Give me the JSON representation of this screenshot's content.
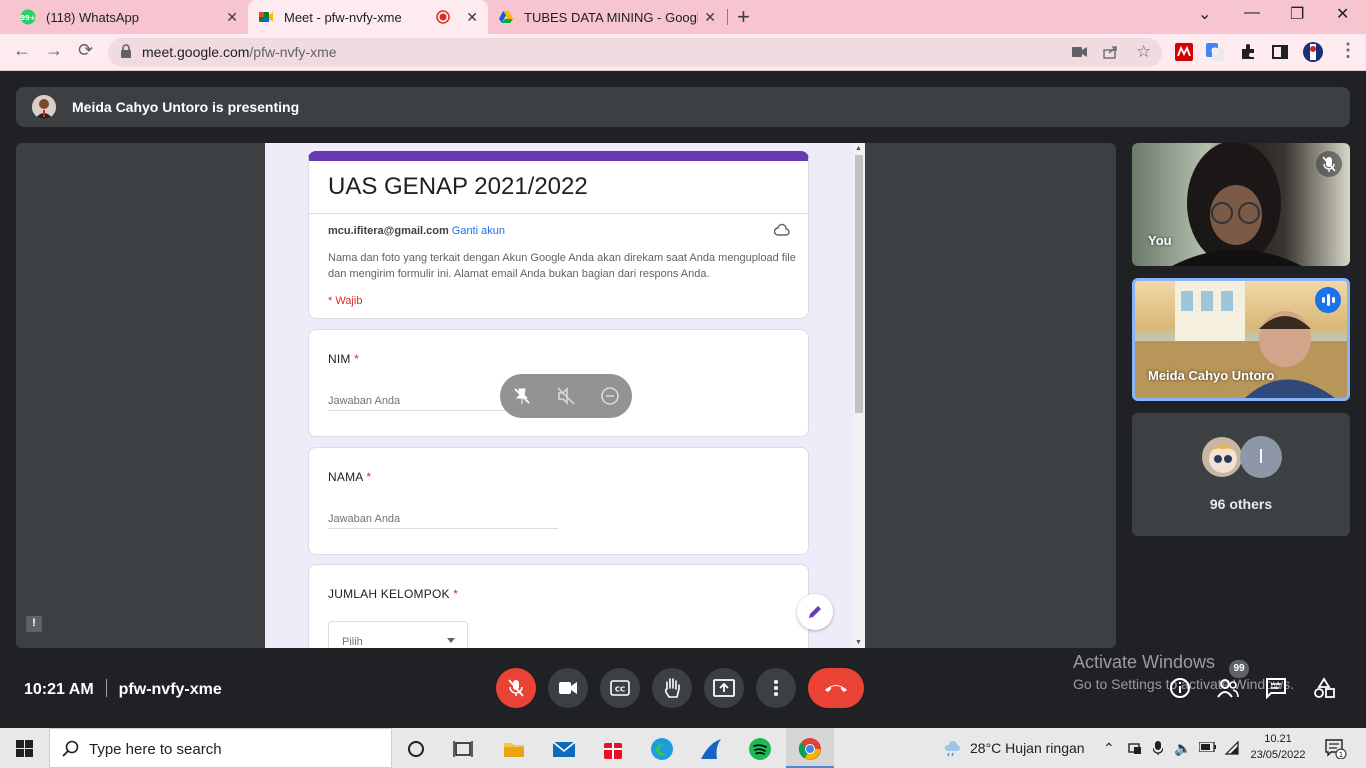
{
  "browser": {
    "tabs": [
      {
        "title": "(118) WhatsApp",
        "favicon_badge": "99+"
      },
      {
        "title": "Meet - pfw-nvfy-xme"
      },
      {
        "title": "TUBES DATA MINING - Google D"
      }
    ],
    "url_domain": "meet.google.com",
    "url_path": "/pfw-nvfy-xme"
  },
  "meet": {
    "banner_text": "Meida Cahyo Untoro is presenting",
    "form": {
      "title": "UAS GENAP 2021/2022",
      "email": "mcu.ifitera@gmail.com",
      "switch_account": "Ganti akun",
      "notice": "Nama dan foto yang terkait dengan Akun Google Anda akan direkam saat Anda mengupload file dan mengirim formulir ini. Alamat email Anda bukan bagian dari respons Anda.",
      "required_note": "* Wajib",
      "questions": [
        {
          "label": "NIM",
          "star": "*",
          "placeholder": "Jawaban Anda"
        },
        {
          "label": "NAMA",
          "star": "*",
          "placeholder": "Jawaban Anda"
        },
        {
          "label": "JUMLAH KELOMPOK",
          "star": "*",
          "select_value": "Pilih"
        }
      ]
    },
    "tiles": {
      "you": "You",
      "presenter": "Meida Cahyo Untoro",
      "others_count": "96 others",
      "others_initial": "I"
    },
    "bottom": {
      "time": "10:21 AM",
      "meeting_code": "pfw-nvfy-xme",
      "participants_badge": "99"
    },
    "watermark": {
      "line1": "Activate Windows",
      "line2": "Go to Settings to activate Windows."
    },
    "colors": {
      "accent": "#673ab7",
      "end_call": "#ea4335",
      "required": "#d93025",
      "link": "#1a73e8"
    }
  },
  "taskbar": {
    "search_placeholder": "Type here to search",
    "weather": "28°C  Hujan ringan",
    "time": "10.21",
    "date": "23/05/2022"
  }
}
